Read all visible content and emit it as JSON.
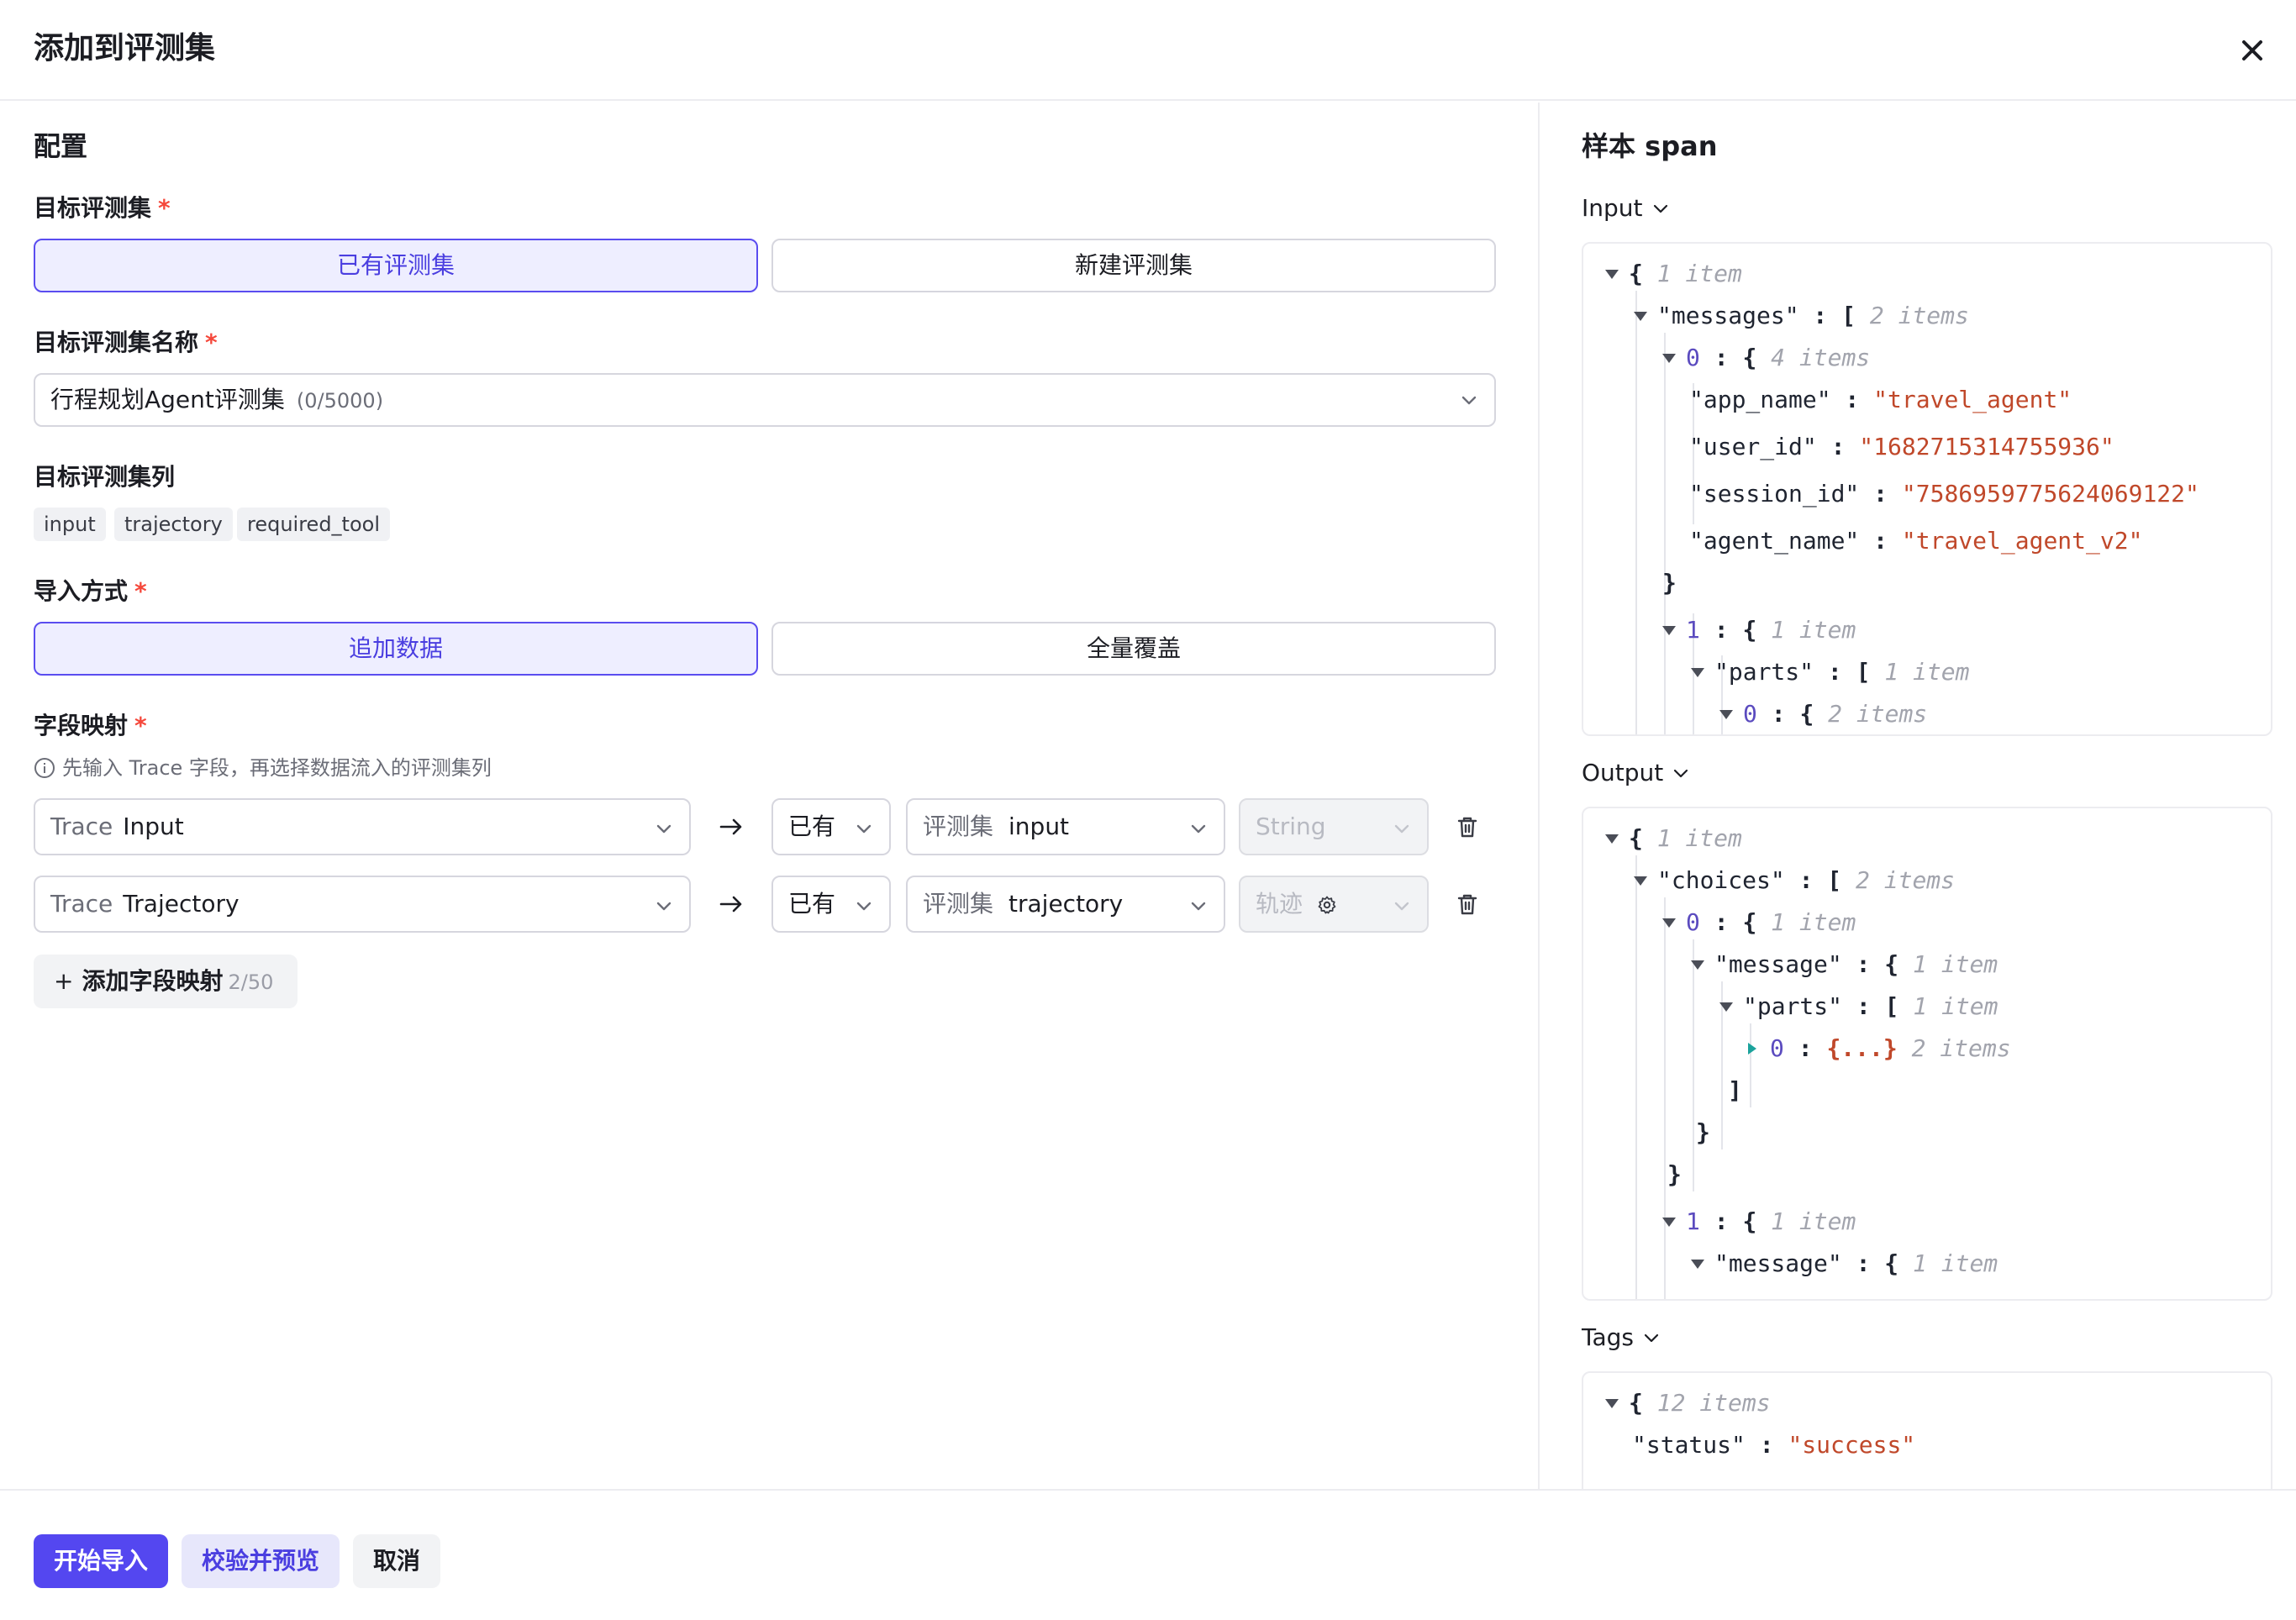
{
  "dialog": {
    "title": "添加到评测集"
  },
  "config": {
    "section_title": "配置",
    "target_dataset": {
      "label": "目标评测集",
      "required_mark": "*",
      "options": [
        "已有评测集",
        "新建评测集"
      ],
      "selected": "已有评测集"
    },
    "dataset_name": {
      "label": "目标评测集名称",
      "required_mark": "*",
      "value": "行程规划Agent评测集",
      "count": "(0/5000)"
    },
    "dataset_columns": {
      "label": "目标评测集列",
      "tags": [
        "input",
        "trajectory",
        "required_tool"
      ]
    },
    "import_mode": {
      "label": "导入方式",
      "required_mark": "*",
      "options": [
        "追加数据",
        "全量覆盖"
      ],
      "selected": "追加数据"
    },
    "field_mapping": {
      "label": "字段映射",
      "required_mark": "*",
      "hint": "先输入 Trace 字段，再选择数据流入的评测集列",
      "rows": [
        {
          "source_prefix": "Trace",
          "source": "Input",
          "mode": "已有",
          "target_prefix": "评测集",
          "target": "input",
          "type": "String"
        },
        {
          "source_prefix": "Trace",
          "source": "Trajectory",
          "mode": "已有",
          "target_prefix": "评测集",
          "target": "trajectory",
          "type": "轨迹"
        }
      ],
      "add_label": "添加字段映射",
      "add_count": "2/50"
    }
  },
  "footer": {
    "start_import": "开始导入",
    "validate_preview": "校验并预览",
    "cancel": "取消"
  },
  "sample": {
    "title": "样本 span",
    "input_label": "Input",
    "output_label": "Output",
    "tags_label": "Tags",
    "input_json": {
      "l1_brace": "{",
      "l1_count": "1 item",
      "l2_key": "\"messages\"",
      "l2_colon": " : ",
      "l2_brace": "[",
      "l2_count": "2 items",
      "l3_idx": "0",
      "l3_colon": " : ",
      "l3_brace": "{",
      "l3_count": "4 items",
      "k_app": "\"app_name\"",
      "v_app": "\"travel_agent\"",
      "k_user": "\"user_id\"",
      "v_user": "\"1682715314755936\"",
      "k_session": "\"session_id\"",
      "v_session": "\"7586959775624069122\"",
      "k_agent": "\"agent_name\"",
      "v_agent": "\"travel_agent_v2\"",
      "close1": "}",
      "l9_idx": "1",
      "l9_brace": "{",
      "l9_count": "1 item",
      "l10_key": "\"parts\"",
      "l10_brace": "[",
      "l10_count": "1 item",
      "l11_idx": "0",
      "l11_brace": "{",
      "l11_count": "2 items",
      "colon": " : "
    },
    "output_json": {
      "l1_brace": "{",
      "l1_count": "1 item",
      "l2_key": "\"choices\"",
      "l2_brace": "[",
      "l2_count": "2 items",
      "l3_idx": "0",
      "l3_brace": "{",
      "l3_count": "1 item",
      "l4_key": "\"message\"",
      "l4_brace": "{",
      "l4_count": "1 item",
      "l5_key": "\"parts\"",
      "l5_brace": "[",
      "l5_count": "1 item",
      "l6_idx": "0",
      "l6_collapsed": "{...}",
      "l6_count": "2 items",
      "close_bracket": "]",
      "close_brace": "}",
      "l10_idx": "1",
      "l10_brace": "{",
      "l10_count": "1 item",
      "l11_key": "\"message\"",
      "l11_brace": "{",
      "l11_count": "1 item",
      "colon": " : "
    },
    "tags_json": {
      "l1_brace": "{",
      "l1_count": "12 items",
      "k_status": "\"status\"",
      "v_status": "\"success\"",
      "colon": " : "
    }
  },
  "colors": {
    "primary": "#5447f0",
    "active_border": "#5a4cf0",
    "active_bg": "#eeeeff",
    "required": "#f5483b",
    "json_string": "#c0482a",
    "json_index": "#5b4bbf"
  }
}
